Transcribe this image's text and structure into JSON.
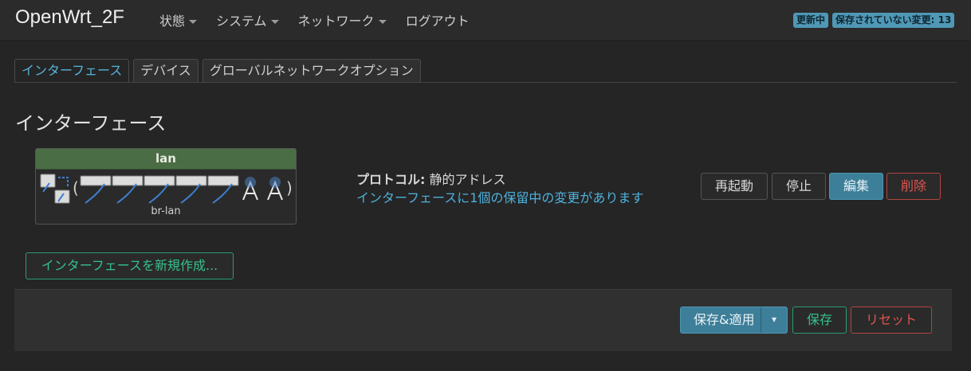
{
  "header": {
    "brand": "OpenWrt_2F",
    "nav": [
      {
        "label": "状態",
        "dropdown": true
      },
      {
        "label": "システム",
        "dropdown": true
      },
      {
        "label": "ネットワーク",
        "dropdown": true
      },
      {
        "label": "ログアウト",
        "dropdown": false
      }
    ],
    "badges": {
      "refreshing": "更新中",
      "unsaved": "保存されていない変更: 13"
    }
  },
  "tabs": [
    "インターフェース",
    "デバイス",
    "グローバルネットワークオプション"
  ],
  "active_tab": 0,
  "section": {
    "title": "インターフェース"
  },
  "interface": {
    "name": "lan",
    "device": "br-lan",
    "protocol_label": "プロトコル:",
    "protocol_value": " 静的アドレス",
    "pending": "インターフェースに1個の保留中の変更があります",
    "actions": {
      "restart": "再起動",
      "stop": "停止",
      "edit": "編集",
      "delete": "削除"
    }
  },
  "add_interface_label": "インターフェースを新規作成...",
  "footer": {
    "save_apply": "保存&適用",
    "save": "保存",
    "reset": "リセット",
    "dropdown_glyph": "▾"
  },
  "colors": {
    "accent": "#4fb1dc",
    "primary": "#3d7e98",
    "danger": "#e0554f",
    "success": "#35c08c",
    "iface_header": "#4b6d45"
  }
}
